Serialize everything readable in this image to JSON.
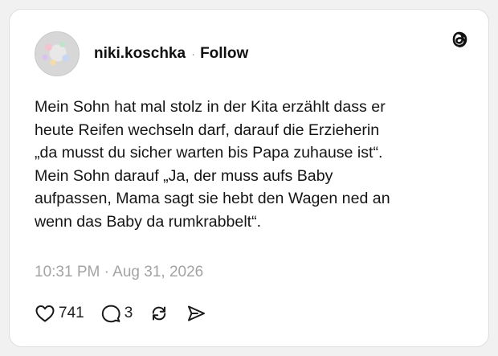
{
  "post": {
    "username": "niki.koschka",
    "separator": "·",
    "follow_label": "Follow",
    "text": "Mein Sohn hat mal stolz in der Kita erzählt dass er\nheute Reifen wechseln darf, darauf die Erzieherin\n„da musst du sicher warten bis Papa zuhause ist“.\nMein Sohn darauf „Ja, der muss aufs Baby\naufpassen, Mama sagt sie hebt den Wagen ned an\nwenn das Baby da rumkrabbelt“.",
    "timestamp": "10:31 PM · Aug 31, 2026"
  },
  "actions": {
    "likes": "741",
    "replies": "3"
  },
  "icons": {
    "logo": "threads-logo-icon",
    "like": "heart-icon",
    "reply": "comment-icon",
    "repost": "repost-icon",
    "share": "send-icon"
  },
  "colors": {
    "background": "#f1f1f1",
    "card": "#ffffff",
    "text": "#151515",
    "muted": "#a3a3a3"
  }
}
